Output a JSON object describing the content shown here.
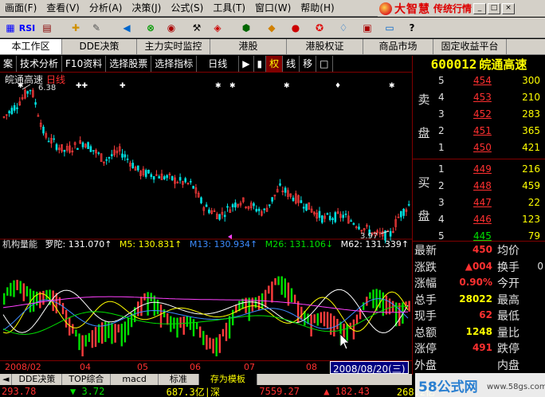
{
  "menu": [
    "画面(F)",
    "查看(V)",
    "分析(A)",
    "决策(J)",
    "公式(S)",
    "工具(T)",
    "窗口(W)",
    "帮助(H)"
  ],
  "brand": {
    "name": "大智慧",
    "sub": "传统行情",
    "win_buttons": [
      "_",
      "□",
      "×"
    ]
  },
  "toolbar": {
    "rsi_label": "RSI"
  },
  "tabs": [
    "本工作区",
    "DDE决策",
    "主力实时监控",
    "港股",
    "港股权证",
    "商品市场",
    "固定收益平台"
  ],
  "bar2": {
    "items": [
      "案",
      "技术分析",
      "F10资料",
      "选择股票",
      "选择指标",
      "日线",
      "▶",
      "▮",
      "权",
      "线",
      "移",
      "□"
    ],
    "active_index": 8
  },
  "stock": {
    "code": "600012",
    "name": "皖通高速"
  },
  "chart": {
    "title": "皖通高速",
    "period": "日线",
    "high_label": "6.38",
    "low_label": "3.97",
    "indicator_line": {
      "name": "机构量能",
      "parts": [
        {
          "text": "罗陀: 131.070↑",
          "color": "#ffffff"
        },
        {
          "text": "M5: 130.831↑",
          "color": "#ffff00"
        },
        {
          "text": "M13: 130.934↑",
          "color": "#3c8cff"
        },
        {
          "text": "M26: 131.106↓",
          "color": "#00e000"
        },
        {
          "text": "M62: 131.339↑",
          "color": "#ffffff"
        },
        {
          "text": "M1",
          "color": "#ff40ff"
        }
      ]
    },
    "date_axis": [
      "2008/02",
      "04",
      "05",
      "06",
      "07",
      "08"
    ],
    "cursor_date": "2008/08/20(三)"
  },
  "chart_data": {
    "type": "candlestick",
    "price_labels": {
      "high": 6.38,
      "low": 3.97
    },
    "x_labels": [
      "2008/02",
      "04",
      "05",
      "06",
      "07",
      "08"
    ]
  },
  "quote": {
    "sell_label": [
      "卖",
      "盘"
    ],
    "buy_label": [
      "买",
      "盘"
    ],
    "sell": [
      {
        "level": "5",
        "price": "454",
        "vol": "300"
      },
      {
        "level": "4",
        "price": "453",
        "vol": "210"
      },
      {
        "level": "3",
        "price": "452",
        "vol": "283"
      },
      {
        "level": "2",
        "price": "451",
        "vol": "365"
      },
      {
        "level": "1",
        "price": "450",
        "vol": "421"
      }
    ],
    "buy": [
      {
        "level": "1",
        "price": "449",
        "vol": "216"
      },
      {
        "level": "2",
        "price": "448",
        "vol": "459"
      },
      {
        "level": "3",
        "price": "447",
        "vol": "22"
      },
      {
        "level": "4",
        "price": "446",
        "vol": "123"
      },
      {
        "level": "5",
        "price": "445",
        "vol": "79"
      }
    ],
    "stats": [
      {
        "l": "最新",
        "v": "450",
        "l2": "均价",
        "v2": "",
        "c": "red"
      },
      {
        "l": "涨跌",
        "v": "▲004",
        "l2": "换手",
        "v2": "0",
        "c": "red"
      },
      {
        "l": "涨幅",
        "v": "0.90%",
        "l2": "今开",
        "v2": "",
        "c": "red"
      },
      {
        "l": "总手",
        "v": "28022",
        "l2": "最高",
        "v2": "",
        "c": "yel"
      },
      {
        "l": "现手",
        "v": "62",
        "l2": "最低",
        "v2": "",
        "c": "red"
      },
      {
        "l": "总额",
        "v": "1248",
        "l2": "量比",
        "v2": "",
        "c": "yel"
      },
      {
        "l": "涨停",
        "v": "491",
        "l2": "跌停",
        "v2": "",
        "c": "red"
      },
      {
        "l": "外盘",
        "v": "",
        "l2": "内盘",
        "v2": "",
        "c": "red"
      }
    ]
  },
  "bottom_tabs": {
    "items": [
      "DDE决策",
      "TOP综合",
      "macd",
      "标准",
      "存为模板"
    ],
    "active_index": 4
  },
  "status": [
    {
      "t": "293.78",
      "c": "#ff3030"
    },
    {
      "t": "▼ 3.72",
      "c": "#00e000"
    },
    {
      "t": "687.3亿|深",
      "c": "#ffff00"
    },
    {
      "t": "7559.27",
      "c": "#ff3030"
    },
    {
      "t": "▲ 182.43",
      "c": "#ff3030"
    },
    {
      "t": "268.2亿",
      "c": "#ffff00"
    }
  ],
  "watermark": {
    "text": "58公式网",
    "url": "www.58gs.com"
  }
}
